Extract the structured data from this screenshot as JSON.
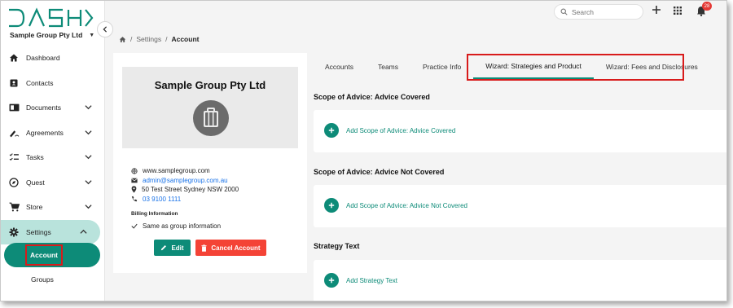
{
  "app": {
    "logo_text": "DASH",
    "org_name": "Sample Group Pty Ltd"
  },
  "sidebar": {
    "items": [
      {
        "label": "Dashboard",
        "icon": "home-icon",
        "has_chevron": false
      },
      {
        "label": "Contacts",
        "icon": "contact-card-icon",
        "has_chevron": false
      },
      {
        "label": "Documents",
        "icon": "documents-icon",
        "has_chevron": true
      },
      {
        "label": "Agreements",
        "icon": "signature-icon",
        "has_chevron": true
      },
      {
        "label": "Tasks",
        "icon": "checklist-icon",
        "has_chevron": true
      },
      {
        "label": "Quest",
        "icon": "compass-icon",
        "has_chevron": true
      },
      {
        "label": "Store",
        "icon": "cart-icon",
        "has_chevron": true
      },
      {
        "label": "Settings",
        "icon": "gear-icon",
        "has_chevron": true
      }
    ],
    "sub_items": [
      {
        "label": "Account"
      },
      {
        "label": "Groups"
      }
    ]
  },
  "topbar": {
    "search_placeholder": "Search",
    "notification_count": "28"
  },
  "breadcrumb": {
    "level1": "Settings",
    "current": "Account"
  },
  "account_card": {
    "title": "Sample Group Pty Ltd",
    "website": "www.samplegroup.com",
    "email": "admin@samplegroup.com.au",
    "address": "50 Test Street Sydney NSW 2000",
    "phone": "03 9100 1111",
    "billing_title": "Billing Information",
    "billing_value": "Same as group information",
    "edit_label": "Edit",
    "cancel_label": "Cancel Account"
  },
  "tabs": [
    {
      "label": "Accounts"
    },
    {
      "label": "Teams"
    },
    {
      "label": "Practice Info"
    },
    {
      "label": "Wizard: Strategies and Product"
    },
    {
      "label": "Wizard: Fees and Disclosures"
    }
  ],
  "sections": [
    {
      "title": "Scope of Advice: Advice Covered",
      "action": "Add Scope of Advice: Advice Covered"
    },
    {
      "title": "Scope of Advice: Advice Not Covered",
      "action": "Add Scope of Advice: Advice Not Covered"
    },
    {
      "title": "Strategy Text",
      "action": "Add Strategy Text"
    }
  ],
  "colors": {
    "accent": "#0d8b78",
    "danger": "#f44336",
    "highlight": "#d81b1b",
    "active_nav_bg": "#b9e3dc"
  }
}
